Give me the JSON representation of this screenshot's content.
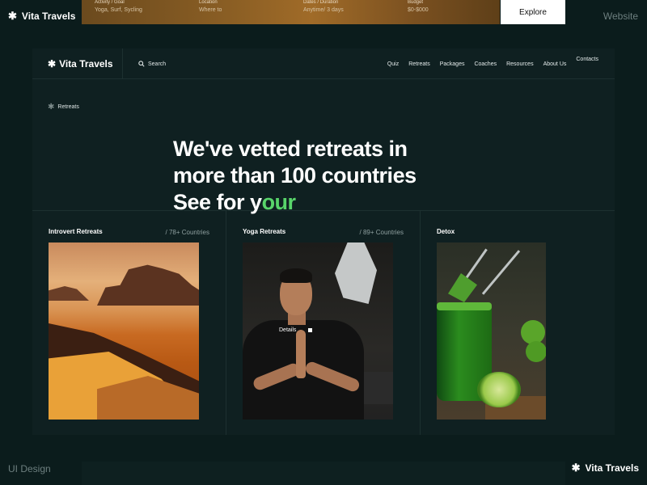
{
  "frame": {
    "brand": "Vita Travels",
    "top_right": "Website",
    "bottom_left": "UI Design"
  },
  "booking_bar": {
    "fields": [
      {
        "label": "Activity / Goal",
        "value": "Yoga, Surf, Sycling"
      },
      {
        "label": "Location",
        "value": "Where to"
      },
      {
        "label": "Dates / Duration",
        "value": "Anytime/ 3 days"
      },
      {
        "label": "Budget",
        "value": "$0-$000"
      }
    ],
    "explore_label": "Explore"
  },
  "nav": {
    "logo": "Vita Travels",
    "search_label": "Search",
    "links": [
      "Quiz",
      "Retreats",
      "Packages",
      "Coaches",
      "Resources",
      "About Us",
      "Contacts"
    ]
  },
  "hero": {
    "breadcrumb": "Retreats",
    "line1": "We've vetted retreats in",
    "line2": "more than 100 countries",
    "line3_prefix": "See for y",
    "line3_highlight": "our",
    "accent_color": "#58d46a"
  },
  "categories": [
    {
      "title": "Introvert Retreats",
      "count": "/ 78+ Countries"
    },
    {
      "title": "Yoga Retreats",
      "count": "/ 89+ Countries",
      "overlay": "Details"
    },
    {
      "title": "Detox",
      "count": ""
    }
  ]
}
